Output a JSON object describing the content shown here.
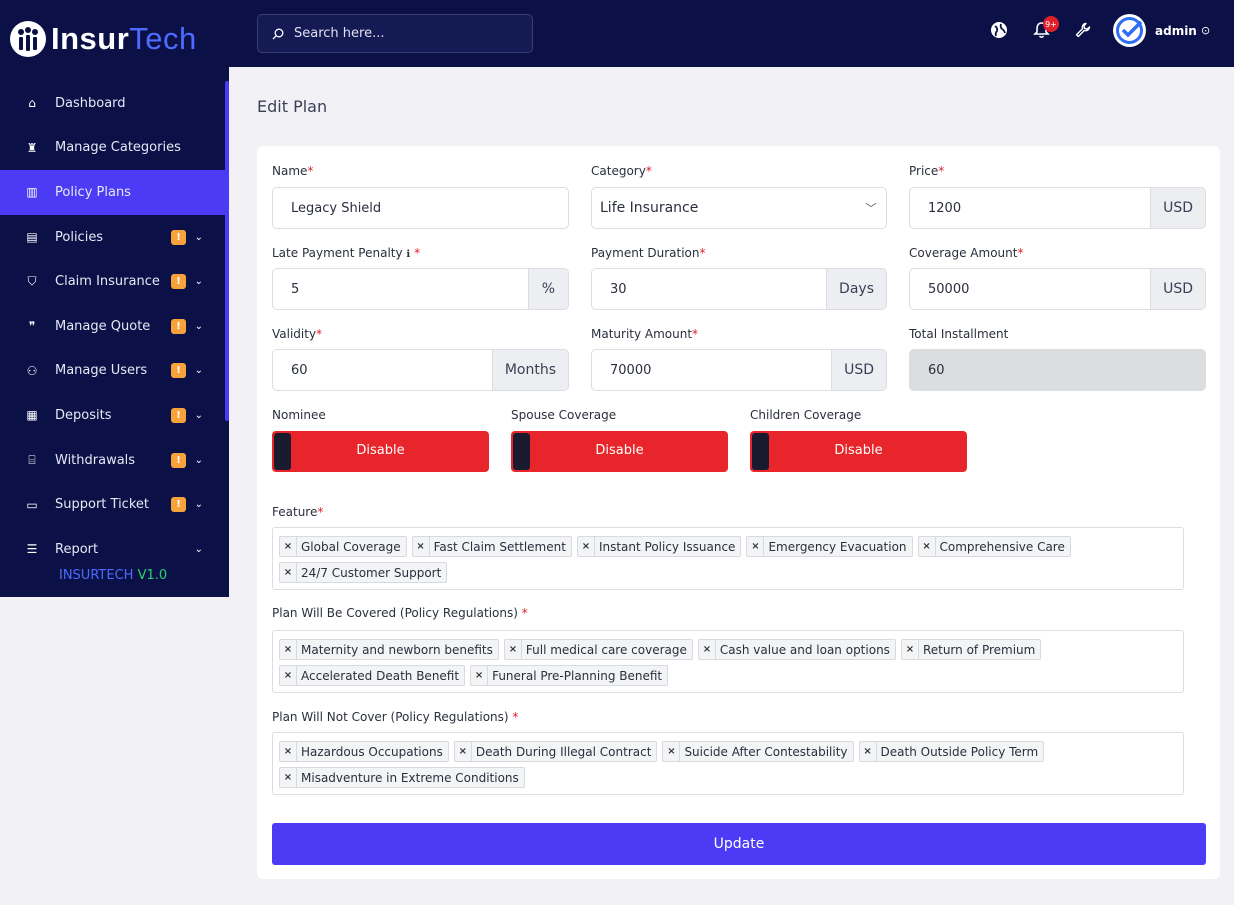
{
  "brand": {
    "part1": "Insur",
    "part2": "Tech"
  },
  "sidebar": {
    "items": [
      {
        "label": "Dashboard",
        "icon": "home-icon",
        "badge": "",
        "chevron": ""
      },
      {
        "label": "Manage Categories",
        "icon": "categories-icon",
        "badge": "",
        "chevron": ""
      },
      {
        "label": "Policy Plans",
        "icon": "chart-icon",
        "badge": "",
        "chevron": "",
        "active": true
      },
      {
        "label": "Policies",
        "icon": "document-icon",
        "badge": "!",
        "chevron": "⌄"
      },
      {
        "label": "Claim Insurance",
        "icon": "shield-icon",
        "badge": "!",
        "chevron": "⌄"
      },
      {
        "label": "Manage Quote",
        "icon": "quote-icon",
        "badge": "!",
        "chevron": "⌄"
      },
      {
        "label": "Manage Users",
        "icon": "users-icon",
        "badge": "!",
        "chevron": "⌄"
      },
      {
        "label": "Deposits",
        "icon": "deposit-icon",
        "badge": "!",
        "chevron": "⌄"
      },
      {
        "label": "Withdrawals",
        "icon": "bank-icon",
        "badge": "!",
        "chevron": "⌄"
      },
      {
        "label": "Support Ticket",
        "icon": "ticket-icon",
        "badge": "!",
        "chevron": "⌄"
      },
      {
        "label": "Report",
        "icon": "list-icon",
        "badge": "",
        "chevron": "⌄"
      }
    ],
    "version_prefix": "INSURTECH ",
    "version_num": "V1.0"
  },
  "header": {
    "search_placeholder": "Search here...",
    "notif_count": "9+",
    "user": "admin"
  },
  "page": {
    "title": "Edit Plan"
  },
  "form": {
    "name_label": "Name",
    "name_value": "Legacy Shield",
    "category_label": "Category",
    "category_value": "Life Insurance",
    "price_label": "Price",
    "price_value": "1200",
    "price_unit": "USD",
    "penalty_label": "Late Payment Penalty",
    "penalty_value": "5",
    "penalty_unit": "%",
    "duration_label": "Payment Duration",
    "duration_value": "30",
    "duration_unit": "Days",
    "coverage_label": "Coverage Amount",
    "coverage_value": "50000",
    "coverage_unit": "USD",
    "validity_label": "Validity",
    "validity_value": "60",
    "validity_unit": "Months",
    "maturity_label": "Maturity Amount",
    "maturity_value": "70000",
    "maturity_unit": "USD",
    "installment_label": "Total Installment",
    "installment_value": "60",
    "nominee_label": "Nominee",
    "nominee_state": "Disable",
    "spouse_label": "Spouse Coverage",
    "spouse_state": "Disable",
    "children_label": "Children Coverage",
    "children_state": "Disable",
    "feature_label": "Feature",
    "features": [
      "Global Coverage",
      "Fast Claim Settlement",
      "Instant Policy Issuance",
      "Emergency Evacuation",
      "Comprehensive Care",
      "24/7 Customer Support"
    ],
    "covered_label": "Plan Will Be Covered (Policy Regulations)",
    "covered": [
      "Maternity and newborn benefits",
      "Full medical care coverage",
      "Cash value and loan options",
      "Return of Premium",
      "Accelerated Death Benefit",
      "Funeral Pre-Planning Benefit"
    ],
    "not_covered_label": "Plan Will Not Cover (Policy Regulations)",
    "not_covered": [
      "Hazardous Occupations",
      "Death During Illegal Contract",
      "Suicide After Contestability",
      "Death Outside Policy Term",
      "Misadventure in Extreme Conditions"
    ],
    "update_label": "Update"
  },
  "colors": {
    "navy": "#0b1146",
    "accent": "#4b3bf4",
    "danger": "#e8252a",
    "badge": "#f7a23a"
  }
}
